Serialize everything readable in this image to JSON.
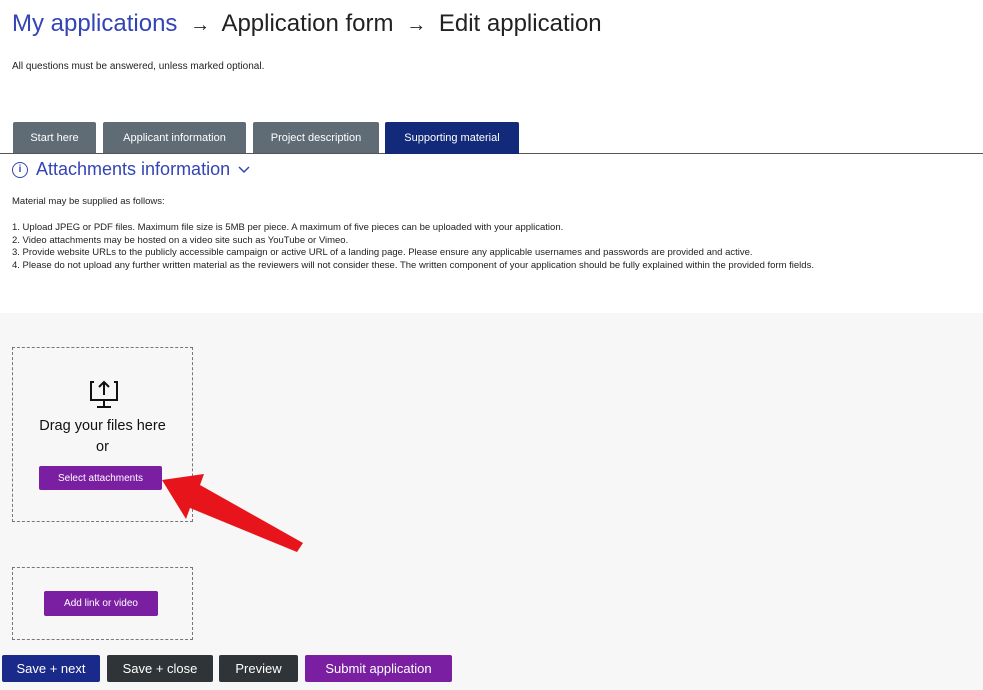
{
  "breadcrumb": {
    "link": "My applications",
    "arrow": "→",
    "step2": "Application form",
    "step3": "Edit application"
  },
  "intro_text": "All questions must be answered, unless marked optional.",
  "tabs": [
    {
      "label": "Start here",
      "active": false
    },
    {
      "label": "Applicant information",
      "active": false
    },
    {
      "label": "Project description",
      "active": false
    },
    {
      "label": "Supporting material",
      "active": true
    }
  ],
  "attachments_info": {
    "heading": "Attachments information",
    "icon": "info-icon",
    "chevron": "chevron-down-icon",
    "intro": "Material may be supplied as follows:",
    "items": [
      "1.  Upload JPEG or PDF files. Maximum file size is 5MB per piece. A maximum of five pieces can be uploaded with your application.",
      "2.  Video attachments may be hosted on a video site such as YouTube or Vimeo.",
      "3.  Provide website URLs to the publicly accessible campaign or active URL of a landing page. Please ensure any applicable usernames and passwords are provided and active.",
      "4.  Please do not upload any further written material as the reviewers will not consider these. The written component of your application should be fully explained within the provided form fields."
    ]
  },
  "dropzone": {
    "icon": "upload-icon",
    "drag_text": "Drag your files here",
    "or_text": "or",
    "button": "Select attachments"
  },
  "linkzone": {
    "button": "Add link or video"
  },
  "footer": {
    "save_next": "Save + next",
    "save_close": "Save + close",
    "preview": "Preview",
    "submit": "Submit application"
  },
  "colors": {
    "link_blue": "#3344b5",
    "active_tab": "#132a7a",
    "inactive_tab": "#5f6b75",
    "purple": "#7b1fa2",
    "annotation_red": "#e8141b"
  }
}
